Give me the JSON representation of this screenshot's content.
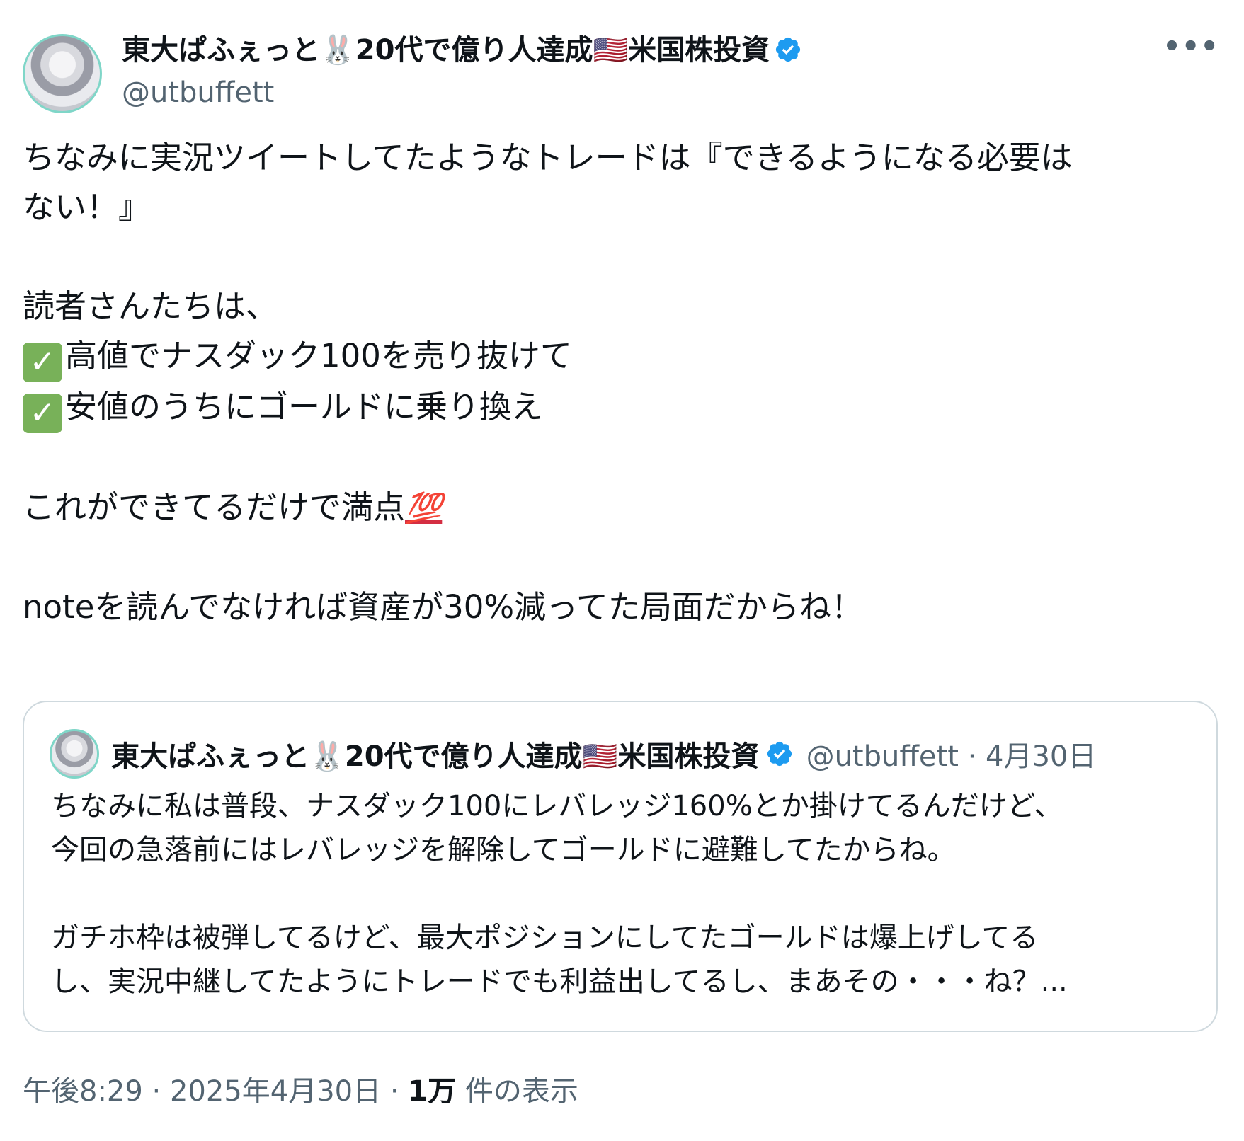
{
  "tweet": {
    "display_name": "東大ぱふぇっと🐰20代で億り人達成🇺🇸米国株投資",
    "handle": "@utbuffett",
    "more_label": "•••",
    "body": {
      "line1": "ちなみに実況ツイートしてたようなトレードは『できるようになる必要は",
      "line2": "ない！』",
      "line3": "読者さんたちは、",
      "check_icon": "✓",
      "line4": "高値でナスダック100を売り抜けて",
      "line5": "安値のうちにゴールドに乗り換え",
      "line6": "これができてるだけで満点",
      "hundred_emoji": "💯",
      "line7": "noteを読んでなければ資産が30%減ってた局面だからね！"
    },
    "quote": {
      "display_name": "東大ぱふぇっと🐰20代で億り人達成🇺🇸米国株投資",
      "handle": "@utbuffett",
      "date": "4月30日",
      "separator": "·",
      "line1": "ちなみに私は普段、ナスダック100にレバレッジ160%とか掛けてるんだけど、",
      "line2": "今回の急落前にはレバレッジを解除してゴールドに避難してたからね。",
      "line3": "ガチホ枠は被弾してるけど、最大ポジションにしてたゴールドは爆上げしてる",
      "line4": "し、実況中継してたようにトレードでも利益出してるし、まあその・・・ね？..."
    },
    "footer": {
      "time": "午後8:29",
      "separator": "·",
      "date": "2025年4月30日",
      "views_count": "1万",
      "views_label": "件の表示"
    },
    "colors": {
      "verified": "#1d9bf0",
      "check_bg": "#78b159",
      "secondary_text": "#536471",
      "border": "#cfd9de"
    }
  }
}
